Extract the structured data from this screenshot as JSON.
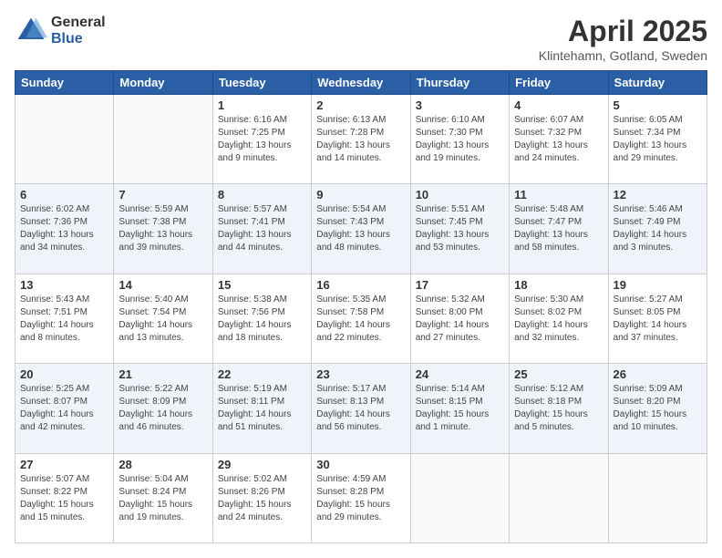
{
  "logo": {
    "general": "General",
    "blue": "Blue"
  },
  "header": {
    "month": "April 2025",
    "location": "Klintehamn, Gotland, Sweden"
  },
  "weekdays": [
    "Sunday",
    "Monday",
    "Tuesday",
    "Wednesday",
    "Thursday",
    "Friday",
    "Saturday"
  ],
  "weeks": [
    [
      {
        "day": "",
        "sunrise": "",
        "sunset": "",
        "daylight": ""
      },
      {
        "day": "",
        "sunrise": "",
        "sunset": "",
        "daylight": ""
      },
      {
        "day": "1",
        "sunrise": "Sunrise: 6:16 AM",
        "sunset": "Sunset: 7:25 PM",
        "daylight": "Daylight: 13 hours and 9 minutes."
      },
      {
        "day": "2",
        "sunrise": "Sunrise: 6:13 AM",
        "sunset": "Sunset: 7:28 PM",
        "daylight": "Daylight: 13 hours and 14 minutes."
      },
      {
        "day": "3",
        "sunrise": "Sunrise: 6:10 AM",
        "sunset": "Sunset: 7:30 PM",
        "daylight": "Daylight: 13 hours and 19 minutes."
      },
      {
        "day": "4",
        "sunrise": "Sunrise: 6:07 AM",
        "sunset": "Sunset: 7:32 PM",
        "daylight": "Daylight: 13 hours and 24 minutes."
      },
      {
        "day": "5",
        "sunrise": "Sunrise: 6:05 AM",
        "sunset": "Sunset: 7:34 PM",
        "daylight": "Daylight: 13 hours and 29 minutes."
      }
    ],
    [
      {
        "day": "6",
        "sunrise": "Sunrise: 6:02 AM",
        "sunset": "Sunset: 7:36 PM",
        "daylight": "Daylight: 13 hours and 34 minutes."
      },
      {
        "day": "7",
        "sunrise": "Sunrise: 5:59 AM",
        "sunset": "Sunset: 7:38 PM",
        "daylight": "Daylight: 13 hours and 39 minutes."
      },
      {
        "day": "8",
        "sunrise": "Sunrise: 5:57 AM",
        "sunset": "Sunset: 7:41 PM",
        "daylight": "Daylight: 13 hours and 44 minutes."
      },
      {
        "day": "9",
        "sunrise": "Sunrise: 5:54 AM",
        "sunset": "Sunset: 7:43 PM",
        "daylight": "Daylight: 13 hours and 48 minutes."
      },
      {
        "day": "10",
        "sunrise": "Sunrise: 5:51 AM",
        "sunset": "Sunset: 7:45 PM",
        "daylight": "Daylight: 13 hours and 53 minutes."
      },
      {
        "day": "11",
        "sunrise": "Sunrise: 5:48 AM",
        "sunset": "Sunset: 7:47 PM",
        "daylight": "Daylight: 13 hours and 58 minutes."
      },
      {
        "day": "12",
        "sunrise": "Sunrise: 5:46 AM",
        "sunset": "Sunset: 7:49 PM",
        "daylight": "Daylight: 14 hours and 3 minutes."
      }
    ],
    [
      {
        "day": "13",
        "sunrise": "Sunrise: 5:43 AM",
        "sunset": "Sunset: 7:51 PM",
        "daylight": "Daylight: 14 hours and 8 minutes."
      },
      {
        "day": "14",
        "sunrise": "Sunrise: 5:40 AM",
        "sunset": "Sunset: 7:54 PM",
        "daylight": "Daylight: 14 hours and 13 minutes."
      },
      {
        "day": "15",
        "sunrise": "Sunrise: 5:38 AM",
        "sunset": "Sunset: 7:56 PM",
        "daylight": "Daylight: 14 hours and 18 minutes."
      },
      {
        "day": "16",
        "sunrise": "Sunrise: 5:35 AM",
        "sunset": "Sunset: 7:58 PM",
        "daylight": "Daylight: 14 hours and 22 minutes."
      },
      {
        "day": "17",
        "sunrise": "Sunrise: 5:32 AM",
        "sunset": "Sunset: 8:00 PM",
        "daylight": "Daylight: 14 hours and 27 minutes."
      },
      {
        "day": "18",
        "sunrise": "Sunrise: 5:30 AM",
        "sunset": "Sunset: 8:02 PM",
        "daylight": "Daylight: 14 hours and 32 minutes."
      },
      {
        "day": "19",
        "sunrise": "Sunrise: 5:27 AM",
        "sunset": "Sunset: 8:05 PM",
        "daylight": "Daylight: 14 hours and 37 minutes."
      }
    ],
    [
      {
        "day": "20",
        "sunrise": "Sunrise: 5:25 AM",
        "sunset": "Sunset: 8:07 PM",
        "daylight": "Daylight: 14 hours and 42 minutes."
      },
      {
        "day": "21",
        "sunrise": "Sunrise: 5:22 AM",
        "sunset": "Sunset: 8:09 PM",
        "daylight": "Daylight: 14 hours and 46 minutes."
      },
      {
        "day": "22",
        "sunrise": "Sunrise: 5:19 AM",
        "sunset": "Sunset: 8:11 PM",
        "daylight": "Daylight: 14 hours and 51 minutes."
      },
      {
        "day": "23",
        "sunrise": "Sunrise: 5:17 AM",
        "sunset": "Sunset: 8:13 PM",
        "daylight": "Daylight: 14 hours and 56 minutes."
      },
      {
        "day": "24",
        "sunrise": "Sunrise: 5:14 AM",
        "sunset": "Sunset: 8:15 PM",
        "daylight": "Daylight: 15 hours and 1 minute."
      },
      {
        "day": "25",
        "sunrise": "Sunrise: 5:12 AM",
        "sunset": "Sunset: 8:18 PM",
        "daylight": "Daylight: 15 hours and 5 minutes."
      },
      {
        "day": "26",
        "sunrise": "Sunrise: 5:09 AM",
        "sunset": "Sunset: 8:20 PM",
        "daylight": "Daylight: 15 hours and 10 minutes."
      }
    ],
    [
      {
        "day": "27",
        "sunrise": "Sunrise: 5:07 AM",
        "sunset": "Sunset: 8:22 PM",
        "daylight": "Daylight: 15 hours and 15 minutes."
      },
      {
        "day": "28",
        "sunrise": "Sunrise: 5:04 AM",
        "sunset": "Sunset: 8:24 PM",
        "daylight": "Daylight: 15 hours and 19 minutes."
      },
      {
        "day": "29",
        "sunrise": "Sunrise: 5:02 AM",
        "sunset": "Sunset: 8:26 PM",
        "daylight": "Daylight: 15 hours and 24 minutes."
      },
      {
        "day": "30",
        "sunrise": "Sunrise: 4:59 AM",
        "sunset": "Sunset: 8:28 PM",
        "daylight": "Daylight: 15 hours and 29 minutes."
      },
      {
        "day": "",
        "sunrise": "",
        "sunset": "",
        "daylight": ""
      },
      {
        "day": "",
        "sunrise": "",
        "sunset": "",
        "daylight": ""
      },
      {
        "day": "",
        "sunrise": "",
        "sunset": "",
        "daylight": ""
      }
    ]
  ]
}
